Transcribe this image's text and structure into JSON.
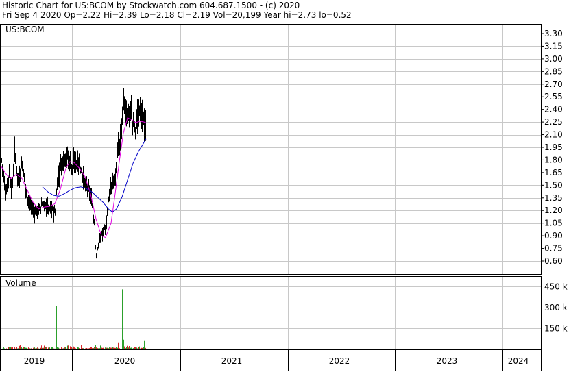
{
  "header": {
    "line1": "Historic Chart for US:BCOM by Stockwatch.com 604.687.1500 - (c) 2020",
    "line2": "Fri Sep  4 2020   Op=2.22  Hi=2.39  Lo=2.18  Cl=2.19  Vol=20,199  Year hi=2.73  lo=0.52"
  },
  "colors": {
    "background": "#ffffff",
    "grid": "#c8c8c8",
    "price_bar": "#000000",
    "ma_short": "#e000e0",
    "ma_long": "#0000c8",
    "volume_up": "#2ca02c",
    "volume_down": "#d62728"
  },
  "chart_data": [
    {
      "type": "line",
      "name": "price",
      "title": "US:BCOM",
      "y_ticks": [
        "3.30",
        "3.15",
        "3.00",
        "2.85",
        "2.70",
        "2.55",
        "2.40",
        "2.25",
        "2.10",
        "1.95",
        "1.80",
        "1.65",
        "1.50",
        "1.35",
        "1.20",
        "1.05",
        "0.90",
        "0.75",
        "0.60"
      ],
      "x_ticks": [
        "2019",
        "2020",
        "2021",
        "2022",
        "2023",
        "2024"
      ],
      "ylim": [
        0.47,
        3.38
      ],
      "grid": true,
      "series_anchors": {
        "close": [
          [
            0,
            1.8
          ],
          [
            6,
            1.38
          ],
          [
            11,
            1.65
          ],
          [
            15,
            1.4
          ],
          [
            19,
            1.9
          ],
          [
            24,
            1.55
          ],
          [
            30,
            1.75
          ],
          [
            36,
            1.4
          ],
          [
            42,
            1.25
          ],
          [
            48,
            1.18
          ],
          [
            54,
            1.22
          ],
          [
            60,
            1.28
          ],
          [
            66,
            1.25
          ],
          [
            72,
            1.22
          ],
          [
            78,
            1.18
          ],
          [
            81,
            1.5
          ],
          [
            86,
            1.75
          ],
          [
            91,
            1.82
          ],
          [
            96,
            1.85
          ],
          [
            102,
            1.72
          ],
          [
            107,
            1.78
          ],
          [
            112,
            1.76
          ],
          [
            117,
            1.65
          ],
          [
            122,
            1.52
          ],
          [
            127,
            1.45
          ],
          [
            131,
            1.32
          ],
          [
            135,
            1.05
          ],
          [
            138,
            0.65
          ],
          [
            142,
            0.85
          ],
          [
            147,
            0.92
          ],
          [
            152,
            1.02
          ],
          [
            157,
            1.38
          ],
          [
            162,
            1.55
          ],
          [
            166,
            1.6
          ],
          [
            170,
            1.95
          ],
          [
            174,
            2.05
          ],
          [
            177,
            2.55
          ],
          [
            180,
            2.4
          ],
          [
            184,
            2.3
          ],
          [
            188,
            2.45
          ],
          [
            191,
            2.2
          ],
          [
            195,
            2.15
          ],
          [
            198,
            2.3
          ],
          [
            202,
            2.45
          ],
          [
            206,
            2.25
          ],
          [
            210,
            2.19
          ]
        ],
        "ma_short": [
          [
            0,
            1.72
          ],
          [
            8,
            1.62
          ],
          [
            14,
            1.58
          ],
          [
            22,
            1.63
          ],
          [
            30,
            1.58
          ],
          [
            38,
            1.44
          ],
          [
            46,
            1.3
          ],
          [
            54,
            1.22
          ],
          [
            62,
            1.24
          ],
          [
            70,
            1.25
          ],
          [
            78,
            1.28
          ],
          [
            86,
            1.45
          ],
          [
            94,
            1.7
          ],
          [
            100,
            1.78
          ],
          [
            106,
            1.77
          ],
          [
            114,
            1.7
          ],
          [
            122,
            1.6
          ],
          [
            130,
            1.4
          ],
          [
            138,
            1.1
          ],
          [
            146,
            0.9
          ],
          [
            152,
            0.88
          ],
          [
            160,
            1.05
          ],
          [
            166,
            1.4
          ],
          [
            172,
            1.78
          ],
          [
            178,
            2.12
          ],
          [
            184,
            2.3
          ],
          [
            190,
            2.28
          ],
          [
            196,
            2.24
          ],
          [
            202,
            2.26
          ],
          [
            208,
            2.25
          ],
          [
            211,
            2.24
          ]
        ],
        "ma_long": [
          [
            60,
            1.48
          ],
          [
            68,
            1.42
          ],
          [
            76,
            1.38
          ],
          [
            84,
            1.37
          ],
          [
            92,
            1.4
          ],
          [
            100,
            1.44
          ],
          [
            108,
            1.47
          ],
          [
            116,
            1.48
          ],
          [
            124,
            1.46
          ],
          [
            132,
            1.42
          ],
          [
            140,
            1.36
          ],
          [
            148,
            1.3
          ],
          [
            156,
            1.22
          ],
          [
            162,
            1.18
          ],
          [
            168,
            1.22
          ],
          [
            176,
            1.36
          ],
          [
            184,
            1.56
          ],
          [
            192,
            1.76
          ],
          [
            200,
            1.9
          ],
          [
            206,
            1.98
          ],
          [
            211,
            2.05
          ]
        ]
      },
      "last": {
        "open": 2.22,
        "high": 2.39,
        "low": 2.18,
        "close": 2.19
      },
      "year_high": 2.73,
      "year_low": 0.52
    },
    {
      "type": "bar",
      "name": "volume",
      "title": "Volume",
      "y_ticks": [
        "450 k",
        "300 k",
        "150 k"
      ],
      "ylim": [
        0,
        520
      ],
      "spikes": [
        {
          "x_index": 12,
          "v": 130,
          "up": false
        },
        {
          "x_index": 80,
          "v": 310,
          "up": true
        },
        {
          "x_index": 88,
          "v": 40,
          "up": true
        },
        {
          "x_index": 107,
          "v": 45,
          "up": false
        },
        {
          "x_index": 137,
          "v": 30,
          "up": true
        },
        {
          "x_index": 170,
          "v": 50,
          "up": false
        },
        {
          "x_index": 176,
          "v": 430,
          "up": true
        },
        {
          "x_index": 178,
          "v": 70,
          "up": true
        },
        {
          "x_index": 206,
          "v": 130,
          "up": false
        },
        {
          "x_index": 208,
          "v": 60,
          "up": true
        }
      ]
    }
  ]
}
